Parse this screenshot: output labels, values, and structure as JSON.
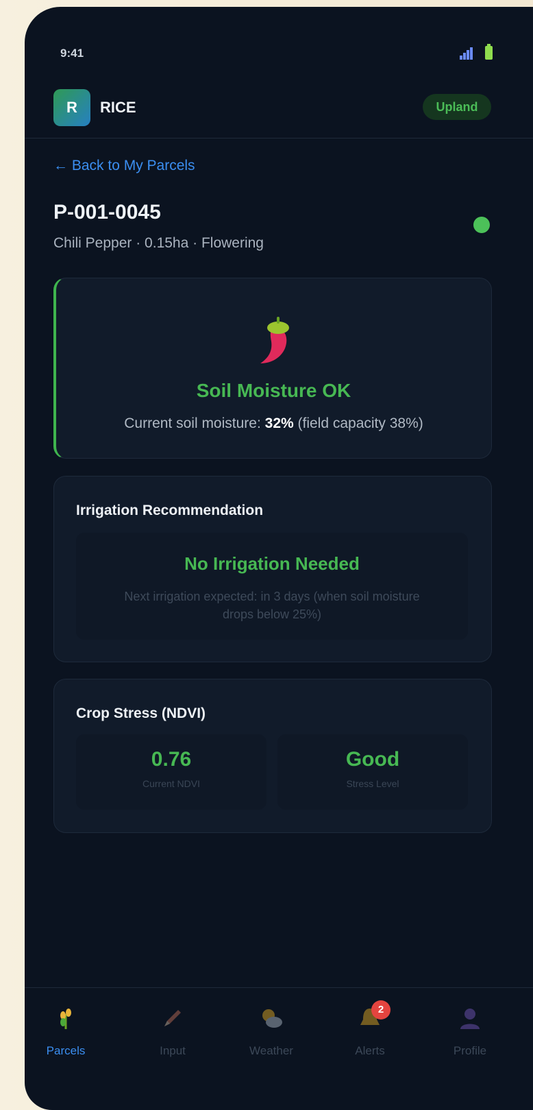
{
  "status": {
    "time": "9:41"
  },
  "header": {
    "logo_letter": "R",
    "title": "RICE",
    "badge": "Upland"
  },
  "nav": {
    "back_label": "← Back to My Parcels"
  },
  "parcel": {
    "id": "P-001-0045",
    "meta": "Chili Pepper · 0.15ha · Flowering",
    "status_color": "#4cc159"
  },
  "moisture_card": {
    "icon": "chili-pepper-icon",
    "title": "Soil Moisture OK",
    "desc_prefix": "Current soil moisture: ",
    "desc_value": "32%",
    "desc_suffix": " (field capacity 38%)"
  },
  "irrigation_card": {
    "title": "Irrigation Recommendation",
    "status": "No Irrigation Needed",
    "desc": "Next irrigation expected: in 3 days (when soil moisture drops below 25%)"
  },
  "ndvi_card": {
    "title": "Crop Stress (NDVI)",
    "items": [
      {
        "value": "0.76",
        "label": "Current NDVI"
      },
      {
        "value": "Good",
        "label": "Stress Level"
      }
    ]
  },
  "bottom_nav": {
    "items": [
      {
        "label": "Parcels",
        "icon": "wheat-icon",
        "active": true
      },
      {
        "label": "Input",
        "icon": "pencil-icon"
      },
      {
        "label": "Weather",
        "icon": "cloud-sun-icon"
      },
      {
        "label": "Alerts",
        "icon": "bell-icon",
        "badge": "2"
      },
      {
        "label": "Profile",
        "icon": "user-icon"
      }
    ]
  },
  "colors": {
    "accent_green": "#47b853",
    "link_blue": "#3b8ef0",
    "background": "#0b1320"
  }
}
